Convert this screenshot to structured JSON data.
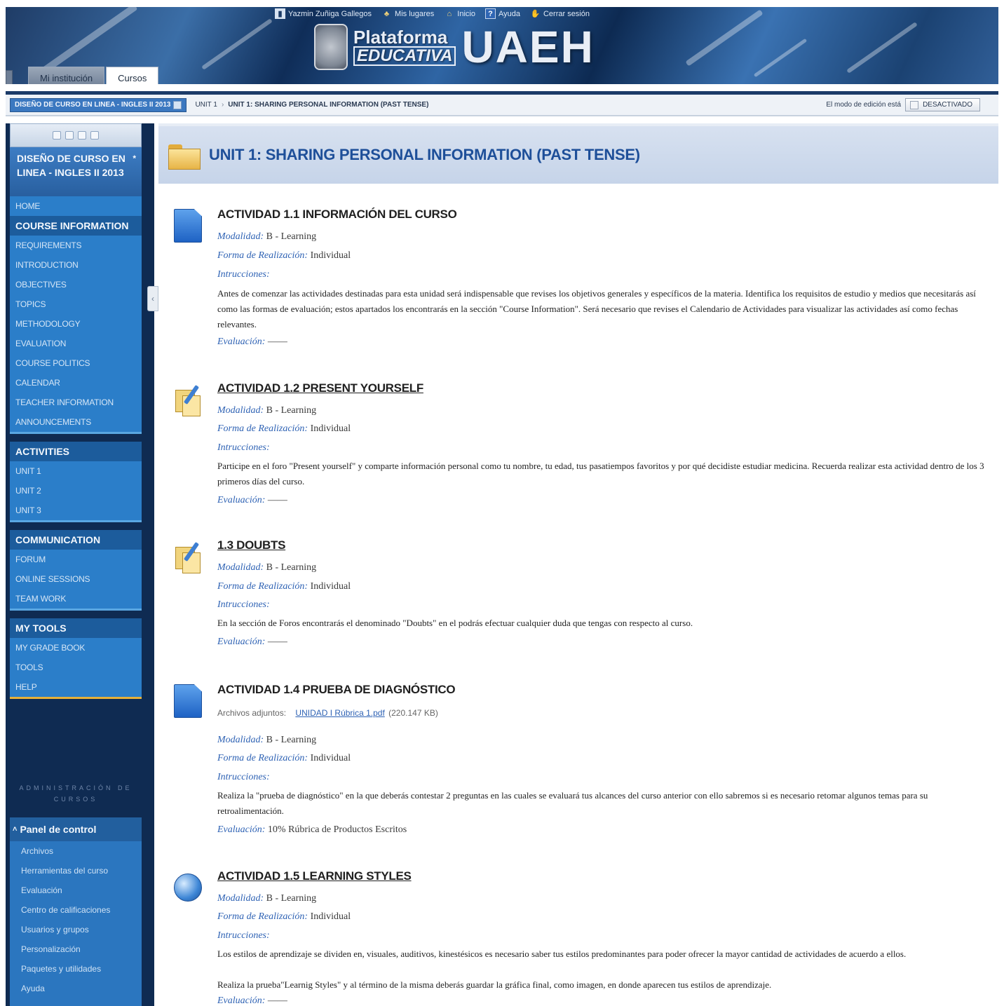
{
  "banner": {
    "user_links": [
      {
        "label": "Yazmin Zuñiga Gallegos",
        "icon": "user-icon"
      },
      {
        "label": "Mis lugares",
        "icon": "places-icon"
      },
      {
        "label": "Inicio",
        "icon": "home-icon"
      },
      {
        "label": "Ayuda",
        "icon": "help-icon"
      },
      {
        "label": "Cerrar sesión",
        "icon": "logout-icon"
      }
    ],
    "logo_line1": "Plataforma",
    "logo_line2": "EDUCATIVA",
    "logo_big": "UAEH",
    "tabs": [
      {
        "label": "Mi institución",
        "active": false
      },
      {
        "label": "Cursos",
        "active": true
      }
    ]
  },
  "breadcrumb": {
    "course": "DISEÑO DE CURSO EN LINEA - INGLES II 2013",
    "items": [
      "UNIT 1",
      "UNIT 1: SHARING PERSONAL INFORMATION (PAST TENSE)"
    ],
    "edit_mode_label": "El modo de edición está",
    "edit_mode_button": "DESACTIVADO"
  },
  "leftnav": {
    "course_title": "DISEÑO DE CURSO EN LINEA - INGLES II 2013",
    "home": "HOME",
    "course_information": {
      "heading": "COURSE INFORMATION",
      "items": [
        "REQUIREMENTS",
        "INTRODUCTION",
        "OBJECTIVES",
        "TOPICS",
        "METHODOLOGY",
        "EVALUATION",
        "COURSE POLITICS",
        "CALENDAR",
        "TEACHER INFORMATION",
        "ANNOUNCEMENTS"
      ]
    },
    "activities": {
      "heading": "ACTIVITIES",
      "items": [
        "UNIT 1",
        "UNIT 2",
        "UNIT 3"
      ]
    },
    "communication": {
      "heading": "COMMUNICATION",
      "items": [
        "FORUM",
        "ONLINE SESSIONS",
        "TEAM WORK"
      ]
    },
    "my_tools": {
      "heading": "MY TOOLS",
      "items": [
        "MY GRADE BOOK",
        "TOOLS",
        "HELP"
      ]
    },
    "admin_label": "ADMINISTRACIÓN DE CURSOS",
    "panel": {
      "heading": "Panel de control",
      "items": [
        "Archivos",
        "Herramientas del curso",
        "Evaluación",
        "Centro de calificaciones",
        "Usuarios y grupos",
        "Personalización",
        "Paquetes y utilidades",
        "Ayuda"
      ]
    }
  },
  "main": {
    "unit_title": "UNIT 1: SHARING PERSONAL INFORMATION (PAST TENSE)",
    "activities": [
      {
        "title": "ACTIVIDAD 1.1 INFORMACIÓN DEL CURSO",
        "icon": "document-icon",
        "modalidad_label": "Modalidad:",
        "modalidad": "B - Learning",
        "forma_label": "Forma de Realización:",
        "forma": "Individual",
        "instr_label": "Intrucciones:",
        "instrucciones": "Antes de comenzar las actividades destinadas para esta unidad será indispensable que revises los objetivos generales y específicos de la materia. Identifica los requisitos de estudio y medios que necesitarás así como las formas de evaluación; estos apartados los encontrarás en la sección \"Course Information\". Será necesario que revises el Calendario de Actividades para visualizar las actividades así como fechas relevantes.",
        "eval_label": "Evaluación:",
        "evaluacion": "——"
      },
      {
        "title": "ACTIVIDAD 1.2 PRESENT YOURSELF",
        "icon": "forum-icon",
        "modalidad_label": "Modalidad:",
        "modalidad": "B - Learning",
        "forma_label": "Forma de Realización:",
        "forma": "Individual",
        "instr_label": "Intrucciones:",
        "instrucciones": "Participe en el foro \"Present yourself\" y comparte información personal como tu nombre, tu edad, tus pasatiempos favoritos y por qué decidiste estudiar medicina. Recuerda realizar esta actividad dentro de los 3 primeros días del curso.",
        "eval_label": "Evaluación:",
        "evaluacion": "——"
      },
      {
        "title": "1.3 DOUBTS",
        "icon": "forum-icon",
        "modalidad_label": "Modalidad:",
        "modalidad": "B - Learning",
        "forma_label": "Forma de Realización:",
        "forma": "Individual",
        "instr_label": "Intrucciones:",
        "instrucciones": "En la sección de Foros encontrarás el denominado \"Doubts\" en el podrás efectuar cualquier duda que tengas con respecto al curso.",
        "eval_label": "Evaluación:",
        "evaluacion": "——"
      },
      {
        "title": "ACTIVIDAD 1.4 PRUEBA DE DIAGNÓSTICO",
        "icon": "document-icon",
        "attach_label": "Archivos adjuntos:",
        "attach_file": "UNIDAD I Rúbrica 1.pdf",
        "attach_size": "(220.147 KB)",
        "modalidad_label": "Modalidad:",
        "modalidad": "B - Learning",
        "forma_label": "Forma de Realización:",
        "forma": "Individual",
        "instr_label": "Intrucciones:",
        "instrucciones": "Realiza la \"prueba de diagnóstico\" en la que deberás contestar 2 preguntas en las cuales se evaluará tus alcances del curso anterior con ello sabremos si es necesario retomar algunos temas para su retroalimentación.",
        "eval_label": "Evaluación:",
        "evaluacion": "10% Rúbrica de Productos Escritos"
      },
      {
        "title": "ACTIVIDAD 1.5 LEARNING STYLES",
        "icon": "globe-icon",
        "modalidad_label": "Modalidad:",
        "modalidad": "B - Learning",
        "forma_label": "Forma de Realización:",
        "forma": "Individual",
        "instr_label": "Intrucciones:",
        "instrucciones": "Los estilos de aprendizaje se dividen en, visuales, auditivos, kinestésicos es necesario saber tus estilos predominantes para poder ofrecer la mayor cantidad de actividades de acuerdo a ellos.",
        "instrucciones2": "Realiza la prueba\"Learnig Styles\" y al término de la misma deberás guardar la gráfica final, como imagen, en donde aparecen tus estilos de aprendizaje.",
        "eval_label": "Evaluación:",
        "evaluacion": "——"
      }
    ]
  }
}
